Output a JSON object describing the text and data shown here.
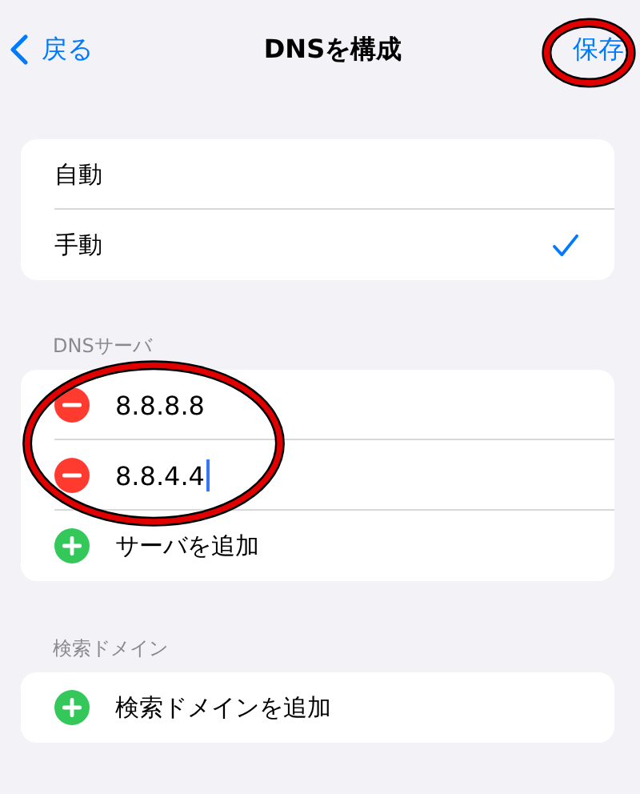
{
  "nav": {
    "back": "戻る",
    "title": "DNSを構成",
    "save": "保存"
  },
  "modes": [
    {
      "label": "自動",
      "selected": false
    },
    {
      "label": "手動",
      "selected": true
    }
  ],
  "servers_section": {
    "header": "DNSサーバ",
    "servers": [
      {
        "address": "8.8.8.8",
        "focused": false
      },
      {
        "address": "8.8.4.4",
        "focused": true
      }
    ],
    "add": "サーバを追加"
  },
  "domains_section": {
    "header": "検索ドメイン",
    "add": "検索ドメインを追加"
  },
  "annotations": [
    {
      "kind": "ellipse"
    },
    {
      "kind": "ellipse"
    }
  ]
}
